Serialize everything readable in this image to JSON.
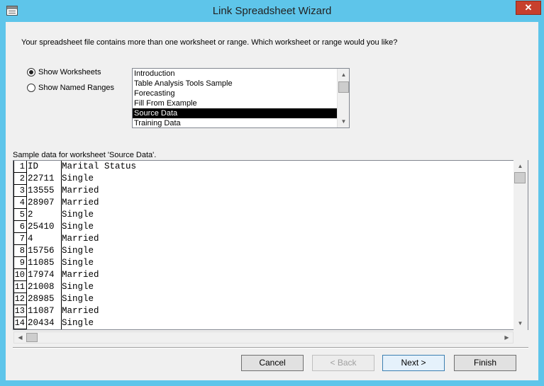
{
  "window": {
    "title": "Link Spreadsheet Wizard",
    "close_label": "✕"
  },
  "instruction": "Your spreadsheet file contains more than one worksheet or range. Which worksheet or range would you like?",
  "options": [
    {
      "label": "Show Worksheets",
      "selected": true
    },
    {
      "label": "Show Named Ranges",
      "selected": false
    }
  ],
  "worksheets": [
    "Introduction",
    "Table Analysis Tools Sample",
    "Forecasting",
    "Fill From Example",
    "Source Data",
    "Training Data"
  ],
  "selected_worksheet": "Source Data",
  "sample_label": "Sample data for worksheet 'Source Data'.",
  "grid": {
    "columns": [
      "ID",
      "Marital Status"
    ],
    "rows": [
      [
        "1",
        "ID",
        "Marital Status"
      ],
      [
        "2",
        "22711",
        "Single"
      ],
      [
        "3",
        "13555",
        "Married"
      ],
      [
        "4",
        "28907",
        "Married"
      ],
      [
        "5",
        "2",
        "Single"
      ],
      [
        "6",
        "25410",
        "Single"
      ],
      [
        "7",
        "4",
        "Married"
      ],
      [
        "8",
        "15756",
        "Single"
      ],
      [
        "9",
        "11085",
        "Single"
      ],
      [
        "10",
        "17974",
        "Married"
      ],
      [
        "11",
        "21008",
        "Single"
      ],
      [
        "12",
        "28985",
        "Single"
      ],
      [
        "13",
        "11087",
        "Married"
      ],
      [
        "14",
        "20434",
        "Single"
      ]
    ]
  },
  "buttons": {
    "cancel": "Cancel",
    "back": "< Back",
    "next": "Next >",
    "finish": "Finish"
  },
  "icons": {
    "up": "▲",
    "down": "▼",
    "left": "◀",
    "right": "▶"
  }
}
